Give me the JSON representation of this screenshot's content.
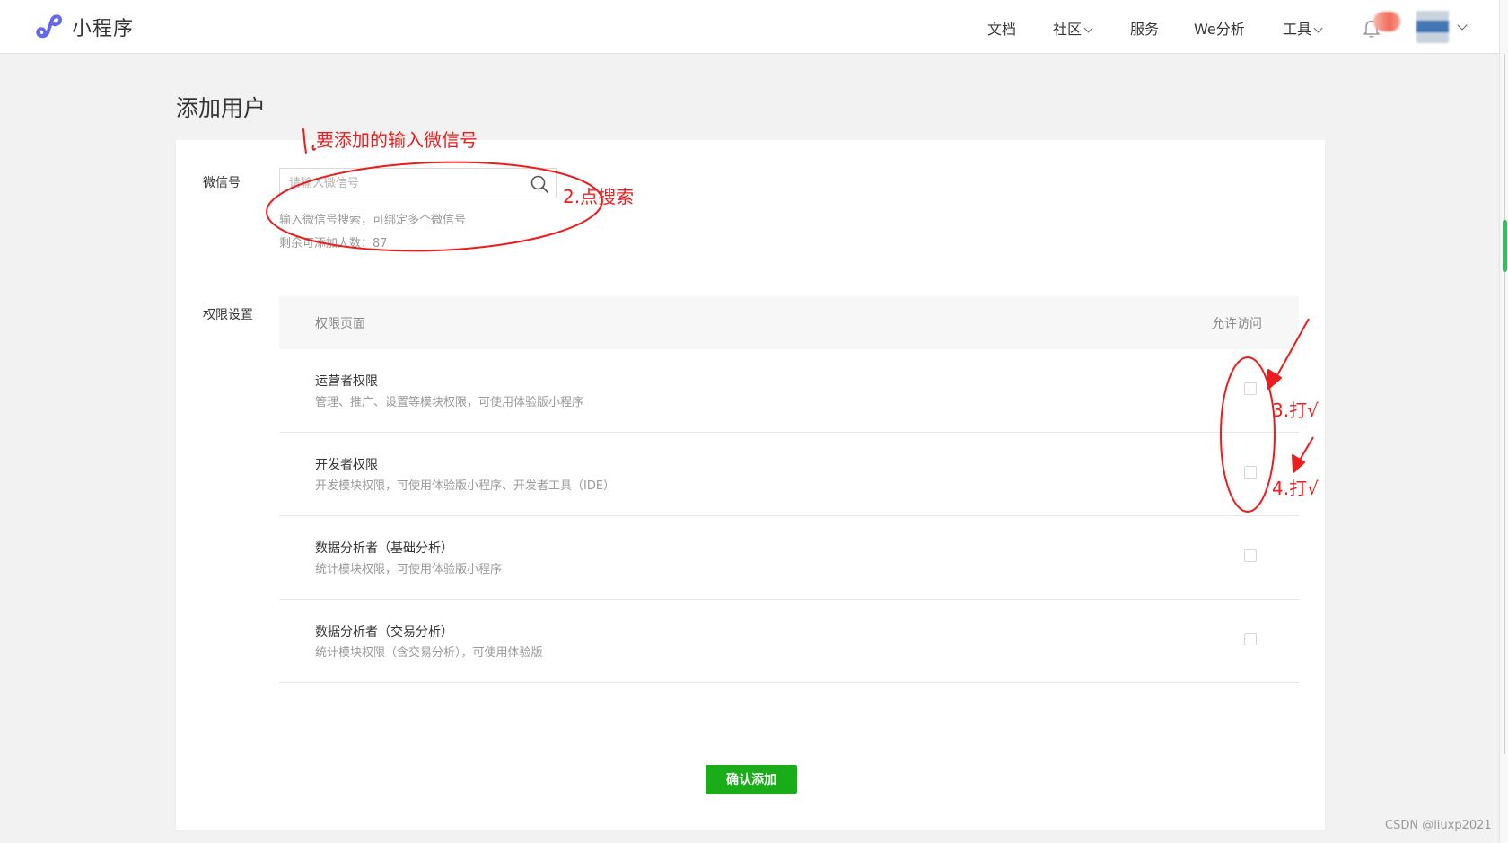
{
  "brand": {
    "name": "小程序",
    "icon": "mini-program-logo"
  },
  "nav": {
    "items": [
      {
        "label": "文档",
        "has_dropdown": false
      },
      {
        "label": "社区",
        "has_dropdown": true
      },
      {
        "label": "服务",
        "has_dropdown": false
      },
      {
        "label": "We分析",
        "has_dropdown": false
      },
      {
        "label": "工具",
        "has_dropdown": true
      }
    ],
    "bell_icon": "bell-icon",
    "avatar_icon": "user-avatar"
  },
  "page": {
    "title": "添加用户"
  },
  "wechat": {
    "label": "微信号",
    "placeholder": "请输入微信号",
    "value": "",
    "hint": "输入微信号搜索，可绑定多个微信号",
    "remaining": "剩余可添加人数：87"
  },
  "permissions": {
    "label": "权限设置",
    "header_page": "权限页面",
    "header_access": "允许访问",
    "items": [
      {
        "title": "运营者权限",
        "desc": "管理、推广、设置等模块权限，可使用体验版小程序",
        "checked": false
      },
      {
        "title": "开发者权限",
        "desc": "开发模块权限，可使用体验版小程序、开发者工具（IDE）",
        "checked": false
      },
      {
        "title": "数据分析者（基础分析）",
        "desc": "统计模块权限，可使用体验版小程序",
        "checked": false
      },
      {
        "title": "数据分析者（交易分析）",
        "desc": "统计模块权限（含交易分析），可使用体验版",
        "checked": false
      }
    ]
  },
  "confirm_label": "确认添加",
  "annotations": {
    "step1": "要添加的输入微信号",
    "step2": "2.点搜索",
    "step3": "3.打√",
    "step4": "4.打√",
    "color": "#ee1c1c"
  },
  "watermark": "CSDN @liuxp2021",
  "colors": {
    "accent_green": "#1aad19",
    "scroll_green": "#2ec05a",
    "brand_purple": "#6467f0"
  }
}
